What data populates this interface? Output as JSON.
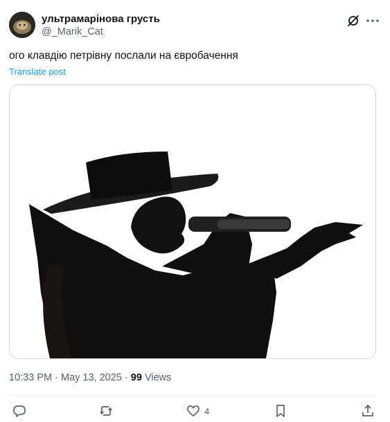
{
  "author": {
    "display_name": "ультрамарінова грусть",
    "handle": "@_Marik_Cat"
  },
  "post": {
    "text": "ого клавдію петрівну послали на євробачення",
    "translate_label": "Translate post",
    "media_icon": "silhouette-photo"
  },
  "meta": {
    "time": "10:33 PM",
    "separator": "·",
    "date": "May 13, 2025",
    "views_count": "99",
    "views_label": "Views"
  },
  "actions": {
    "reply_icon": "reply-icon",
    "repost_icon": "repost-icon",
    "like_icon": "heart-icon",
    "like_count": "4",
    "bookmark_icon": "bookmark-icon",
    "share_icon": "share-icon"
  },
  "colors": {
    "text": "#0f1419",
    "secondary": "#536471",
    "link": "#1d9bf0",
    "border": "#cfd9de"
  }
}
